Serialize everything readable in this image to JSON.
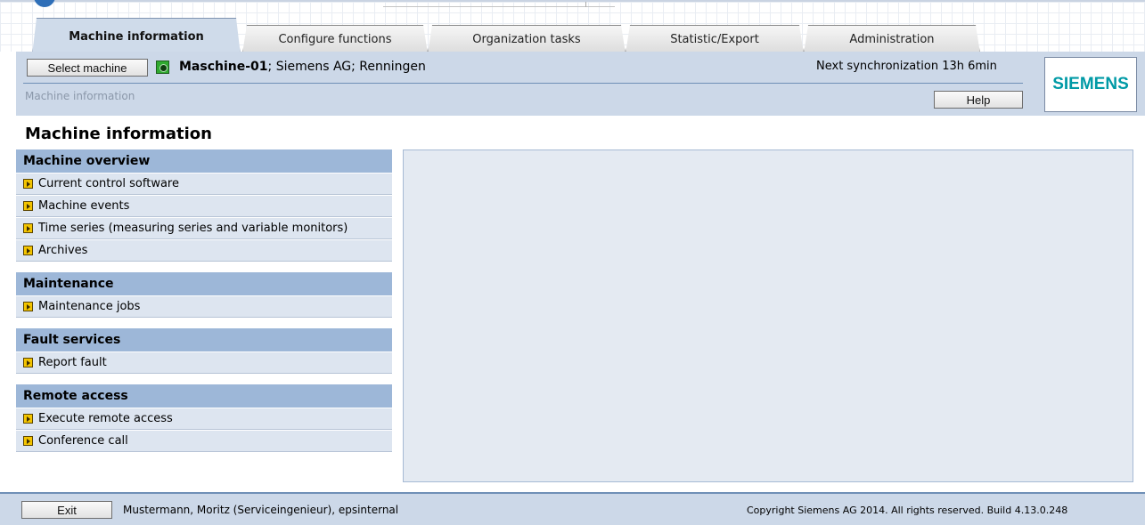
{
  "tabs": [
    {
      "label": "Machine information",
      "active": true
    },
    {
      "label": "Configure functions",
      "active": false
    },
    {
      "label": "Organization tasks",
      "active": false
    },
    {
      "label": "Statistic/Export",
      "active": false
    },
    {
      "label": "Administration",
      "active": false
    }
  ],
  "header": {
    "select_machine_label": "Select machine",
    "machine_name": "Maschine-01",
    "machine_details": "; Siemens AG; Renningen",
    "sync_text": "Next synchronization 13h 6min",
    "breadcrumb": "Machine information",
    "help_label": "Help",
    "logo_text": "SIEMENS",
    "logo_color": "#009aa6",
    "status_color": "#2faa2f"
  },
  "page_title": "Machine information",
  "sidebar": {
    "groups": [
      {
        "title": "Machine overview",
        "items": [
          {
            "label": "Current control software"
          },
          {
            "label": "Machine events"
          },
          {
            "label": "Time series (measuring series and variable monitors)"
          },
          {
            "label": "Archives"
          }
        ]
      },
      {
        "title": "Maintenance",
        "items": [
          {
            "label": "Maintenance jobs"
          }
        ]
      },
      {
        "title": "Fault services",
        "items": [
          {
            "label": "Report fault"
          }
        ]
      },
      {
        "title": "Remote access",
        "items": [
          {
            "label": "Execute remote access"
          },
          {
            "label": "Conference call"
          }
        ]
      }
    ]
  },
  "footer": {
    "exit_label": "Exit",
    "user_info": "Mustermann, Moritz (Serviceingenieur), epsinternal",
    "copyright": "Copyright Siemens AG 2014. All rights reserved. Build 4.13.0.248"
  }
}
